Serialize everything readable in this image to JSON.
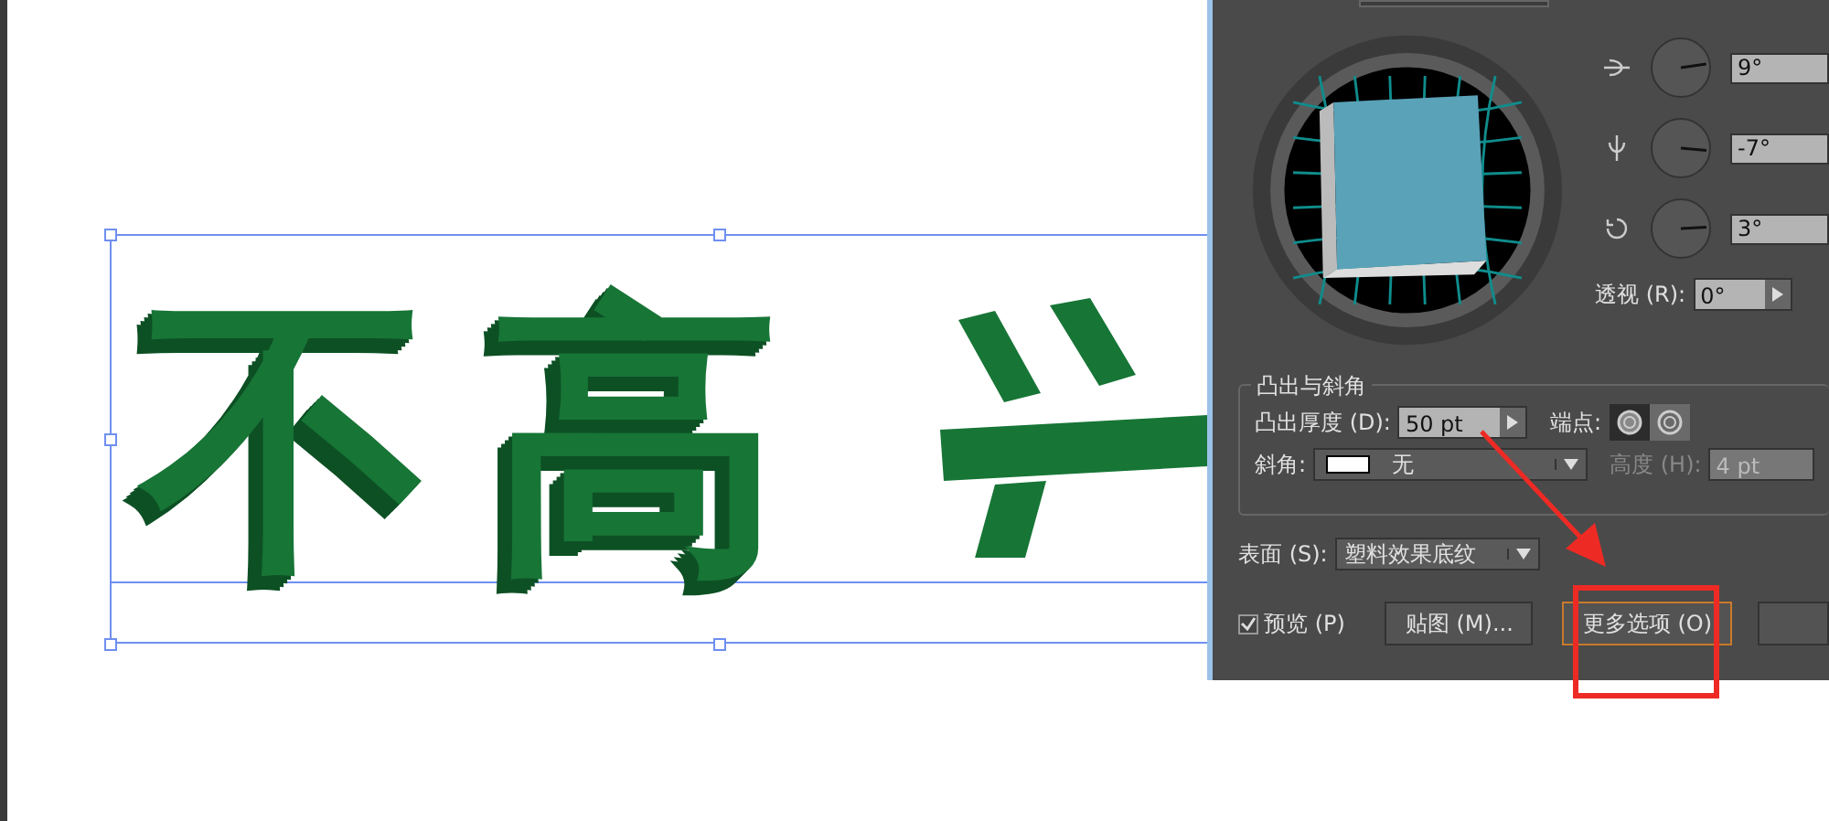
{
  "artwork": {
    "text": "不高"
  },
  "dialog": {
    "rotation": [
      {
        "kind": "x",
        "value": "9°"
      },
      {
        "kind": "y",
        "value": "-7°"
      },
      {
        "kind": "z",
        "value": "3°"
      }
    ],
    "perspective": {
      "label": "透视 (R):",
      "value": "0°"
    },
    "extrude_group": {
      "title": "凸出与斜角",
      "depth_label": "凸出厚度 (D):",
      "depth_value": "50 pt",
      "cap_label": "端点:",
      "caps": [
        {
          "selected": true
        },
        {
          "selected": false
        }
      ],
      "bevel_label": "斜角:",
      "bevel_value": "无",
      "height_label": "高度 (H):",
      "height_value": "4 pt",
      "height_disabled": true
    },
    "surface": {
      "label": "表面 (S):",
      "value": "塑料效果底纹"
    },
    "preview": {
      "label": "预览 (P)",
      "checked": true
    },
    "buttons": [
      {
        "label": "贴图 (M)...",
        "focused": false
      },
      {
        "label": "更多选项 (O)",
        "focused": true
      }
    ]
  }
}
